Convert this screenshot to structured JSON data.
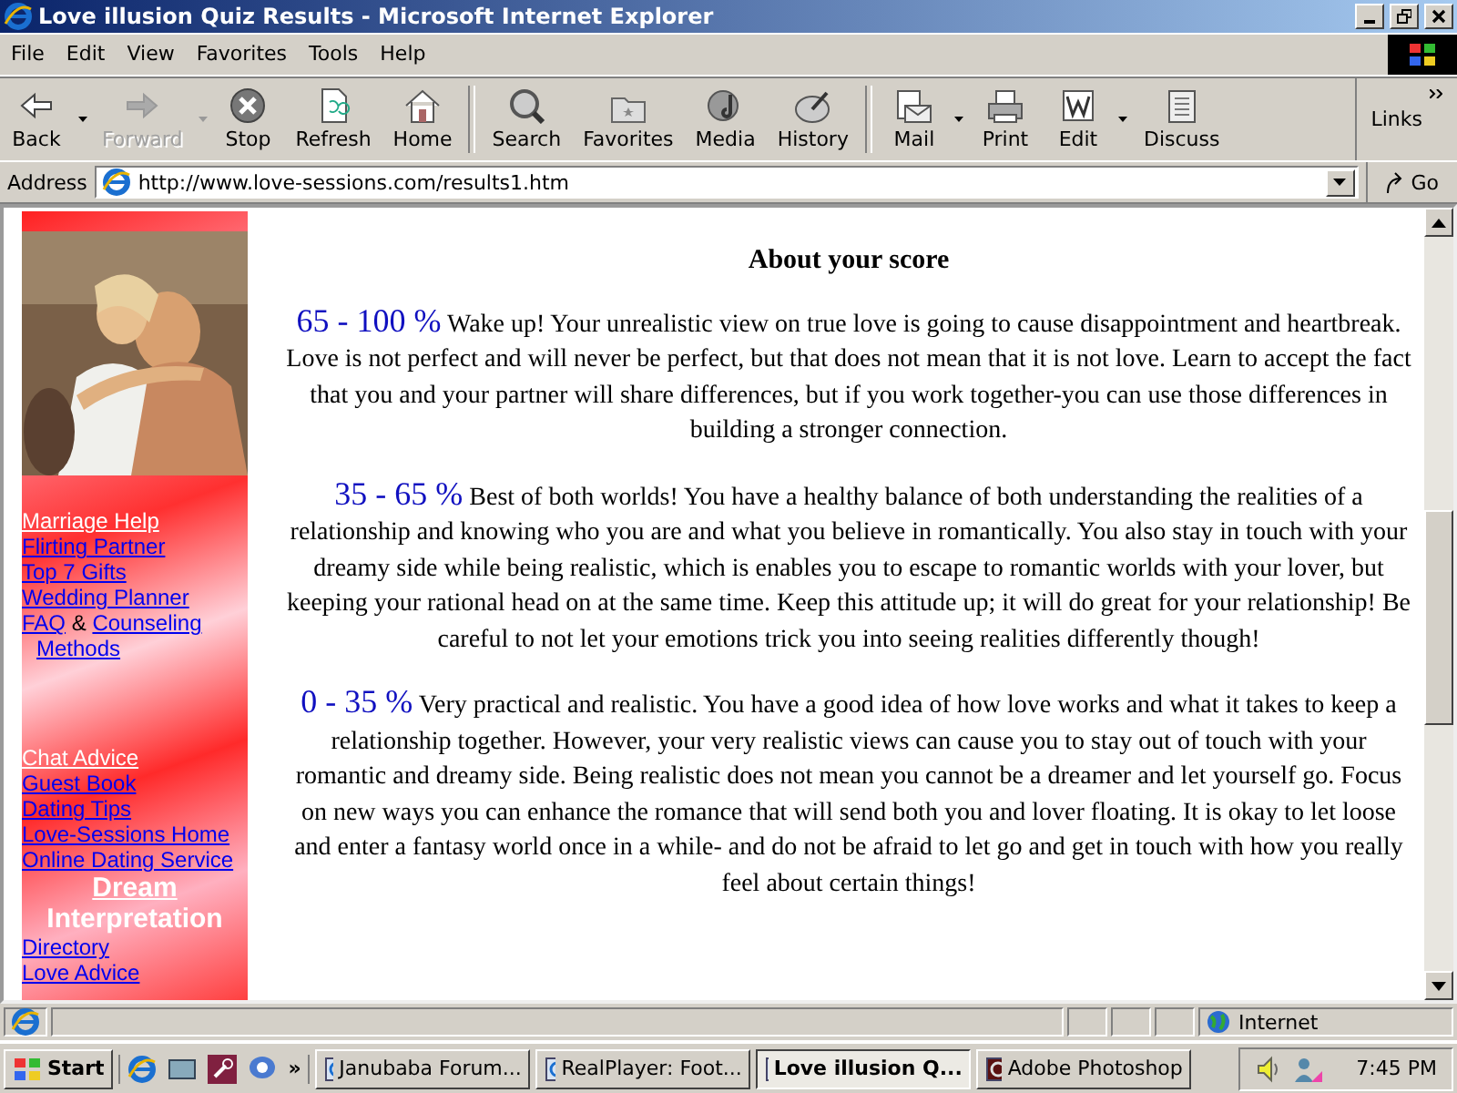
{
  "window": {
    "title": "Love illusion Quiz Results - Microsoft Internet Explorer"
  },
  "menu": [
    "File",
    "Edit",
    "View",
    "Favorites",
    "Tools",
    "Help"
  ],
  "toolbar": [
    {
      "label": "Back",
      "disabled": false,
      "has_menu": true
    },
    {
      "label": "Forward",
      "disabled": true,
      "has_menu": true
    },
    {
      "label": "Stop",
      "disabled": false,
      "has_menu": false
    },
    {
      "label": "Refresh",
      "disabled": false,
      "has_menu": false
    },
    {
      "label": "Home",
      "disabled": false,
      "has_menu": false
    },
    {
      "label": "Search",
      "disabled": false,
      "has_menu": false
    },
    {
      "label": "Favorites",
      "disabled": false,
      "has_menu": false
    },
    {
      "label": "Media",
      "disabled": false,
      "has_menu": false
    },
    {
      "label": "History",
      "disabled": false,
      "has_menu": false
    },
    {
      "label": "Mail",
      "disabled": false,
      "has_menu": true
    },
    {
      "label": "Print",
      "disabled": false,
      "has_menu": false
    },
    {
      "label": "Edit",
      "disabled": false,
      "has_menu": true
    },
    {
      "label": "Discuss",
      "disabled": false,
      "has_menu": false
    }
  ],
  "links_label": "Links",
  "address": {
    "label": "Address",
    "value": "http://www.love-sessions.com/results1.htm",
    "go": "Go"
  },
  "sidebar": {
    "groups": [
      [
        {
          "kind": "heading",
          "text": "Marriage Help"
        },
        {
          "kind": "link",
          "text": "Flirting Partner"
        },
        {
          "kind": "link",
          "text": "Top 7 Gifts"
        },
        {
          "kind": "link",
          "text": "Wedding Planner"
        },
        {
          "kind": "pair",
          "text": "FAQ",
          "joiner": "&",
          "second": "Counseling Methods"
        }
      ],
      [
        {
          "kind": "heading",
          "text": "Chat Advice"
        },
        {
          "kind": "link",
          "text": "Guest Book"
        },
        {
          "kind": "link",
          "text": "Dating Tips"
        },
        {
          "kind": "link",
          "text": "Love-Sessions Home"
        },
        {
          "kind": "link",
          "text": "Online Dating Service"
        },
        {
          "kind": "title",
          "text": "Dream"
        },
        {
          "kind": "title-plain",
          "text": "Interpretation"
        },
        {
          "kind": "link",
          "text": "Directory"
        },
        {
          "kind": "link",
          "text": "Love Advice"
        }
      ]
    ]
  },
  "content": {
    "heading": "About your score",
    "sections": [
      {
        "score": "65 - 100 %",
        "text": "Wake up! Your unrealistic view on true love is going to cause disappointment and heartbreak. Love is not perfect and will never be perfect, but that does not mean that it is not love. Learn to accept the fact that you and your partner will share differences, but if you work together-you can use those differences in building a stronger connection."
      },
      {
        "score": "35 - 65 %",
        "text": "Best of both worlds! You have a healthy balance of both understanding the realities of a relationship and knowing who you are and what you believe in romantically. You also stay in touch with your dreamy side while being realistic, which is enables you to escape to romantic worlds with your lover, but keeping your rational head on at the same time. Keep this attitude up; it will do great for your relationship! Be careful to not let your emotions trick you into seeing realities differently though!"
      },
      {
        "score": "0 - 35 %",
        "text": "Very practical and realistic. You have a good idea of how love works and what it takes to keep a relationship together. However, your very realistic views can cause you to stay out of touch with your romantic and dreamy side. Being realistic does not mean you cannot be a dreamer and let yourself go. Focus on new ways you can enhance the romance that will send both you and lover floating. It is okay to let loose and enter a fantasy world once in a while- and do not be afraid to let go and get in touch with how you really feel about certain things!"
      }
    ]
  },
  "status_bar": {
    "zone": "Internet"
  },
  "taskbar": {
    "start": "Start",
    "quick_launch_more": "»",
    "tasks": [
      {
        "label": "Janubaba Forum...",
        "selected": false
      },
      {
        "label": "RealPlayer: Foot...",
        "selected": false
      },
      {
        "label": "Love illusion Q...",
        "selected": true
      },
      {
        "label": "Adobe Photoshop",
        "selected": false
      }
    ],
    "clock": "7:45 PM"
  }
}
